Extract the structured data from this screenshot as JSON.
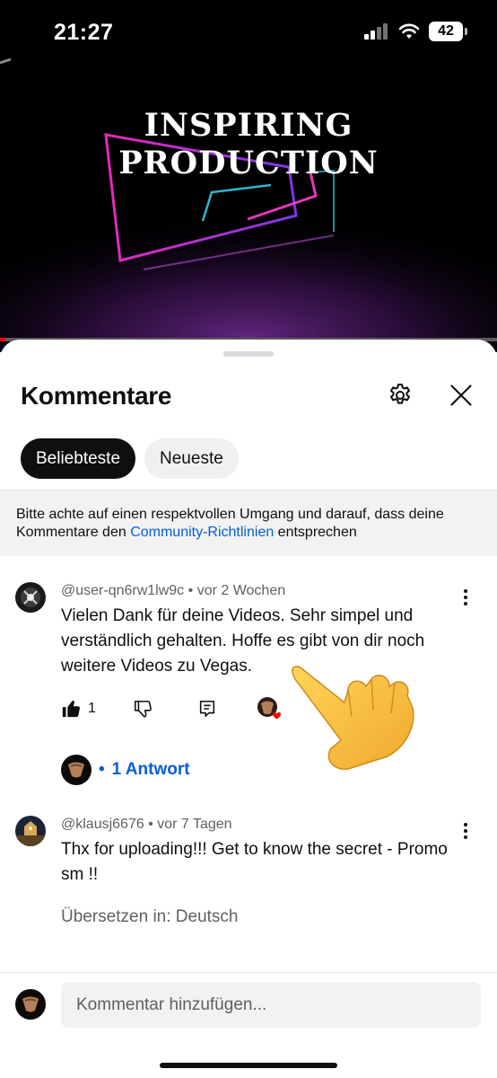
{
  "status_bar": {
    "time": "21:27",
    "battery": "42"
  },
  "video": {
    "title_line1": "INSPIRING",
    "title_line2": "PRODUCTION",
    "progress": 0.01
  },
  "sheet": {
    "title": "Kommentare",
    "chips": [
      {
        "label": "Beliebteste",
        "active": true
      },
      {
        "label": "Neueste",
        "active": false
      }
    ],
    "notice": {
      "text_before": "Bitte achte auf einen respektvollen Umgang und darauf, dass deine Kommentare den ",
      "link": "Community-Richtlinien",
      "text_after": " entsprechen"
    }
  },
  "comments": [
    {
      "author": "@user-qn6rw1lw9c",
      "age": "vor 2 Wochen",
      "text": "Vielen Dank für deine Videos. Sehr simpel und verständlich gehalten. Hoffe es gibt von dir noch weitere Videos zu Vegas.",
      "likes": "1",
      "replies": "1 Antwort",
      "creator_hearted": true
    },
    {
      "author": "@klausj6676",
      "age": "vor 7 Tagen",
      "text": "Thx for uploading!!! Get to know the secret - Promo sm !!",
      "translate": "Übersetzen in: Deutsch"
    }
  ],
  "composer": {
    "placeholder": "Kommentar hinzufügen..."
  },
  "colors": {
    "accent_link": "#065fd4",
    "heart": "#ff0000",
    "chip_active": "#0f0f0f"
  },
  "icons": {
    "settings": "gear-icon",
    "close": "close-icon",
    "like": "thumbs-up-icon",
    "dislike": "thumbs-down-icon",
    "reply": "comment-icon",
    "more": "more-vert-icon"
  }
}
